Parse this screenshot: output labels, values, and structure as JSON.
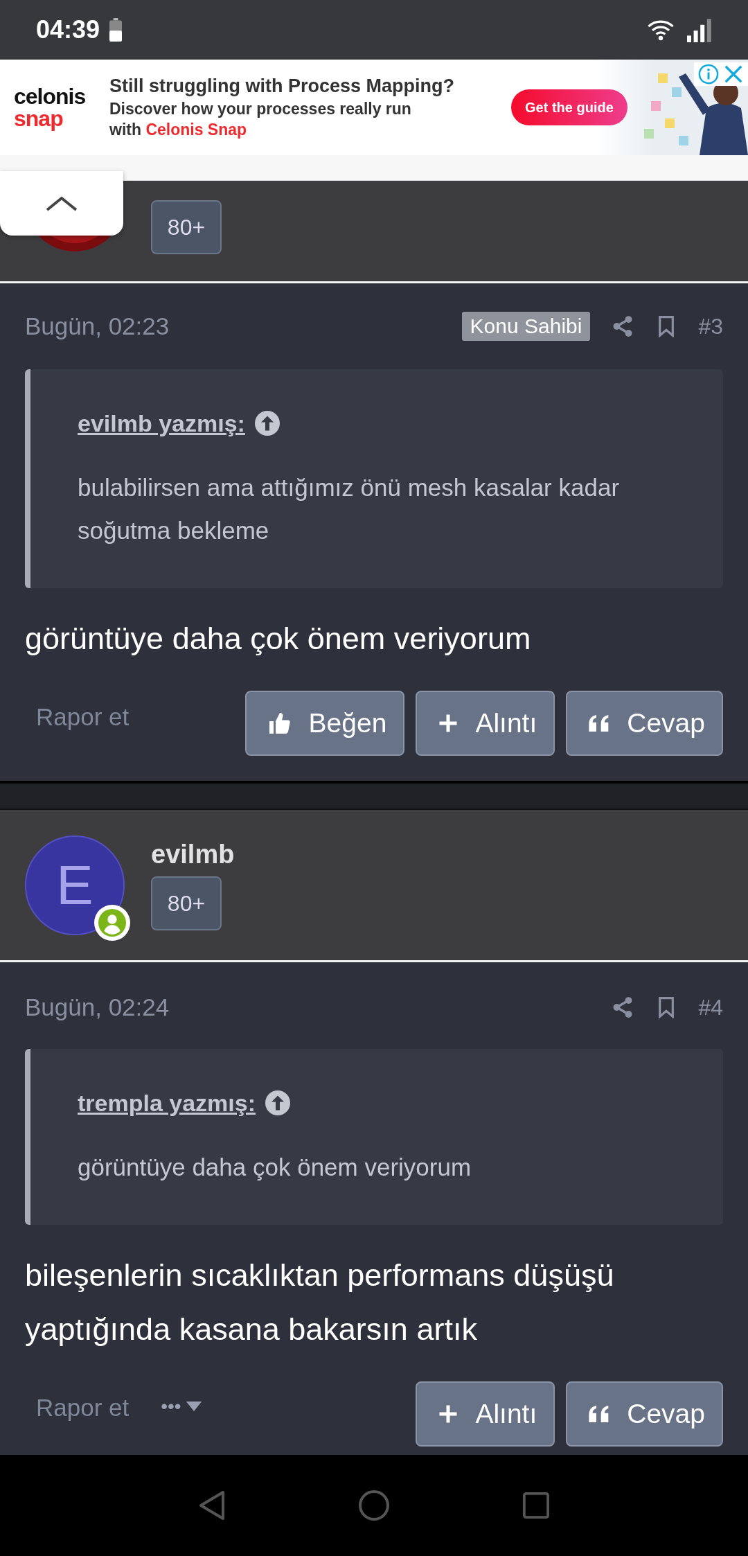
{
  "status_bar": {
    "time": "04:39"
  },
  "ad": {
    "logo_top": "celonis",
    "logo_bottom": "snap",
    "headline": "Still struggling with Process Mapping?",
    "body": "Discover how your processes really run with",
    "body_highlight": "Celonis Snap",
    "cta": "Get the guide"
  },
  "posts": [
    {
      "author": {
        "badge": "80+"
      },
      "date": "Bugün, 02:23",
      "owner_tag": "Konu Sahibi",
      "number": "#3",
      "quote": {
        "author": "evilmb yazmış:",
        "text": "bulabilirsen ama attığımız önü mesh kasalar kadar soğutma bekleme"
      },
      "body": "görüntüye daha çok önem veriyorum",
      "report": "Rapor et",
      "actions": [
        {
          "kind": "like",
          "label": "Beğen"
        },
        {
          "kind": "quote",
          "label": "Alıntı"
        },
        {
          "kind": "reply",
          "label": "Cevap"
        }
      ]
    },
    {
      "author": {
        "kind": "letter",
        "initial": "E",
        "name": "evilmb",
        "badge": "80+",
        "online": true
      },
      "date": "Bugün, 02:24",
      "number": "#4",
      "quote": {
        "author": "trempla yazmış:",
        "text": "görüntüye daha çok önem veriyorum"
      },
      "body": "bileşenlerin sıcaklıktan performans düşüşü yaptığında kasana bakarsın artık",
      "report": "Rapor et",
      "more": "•••",
      "actions": [
        {
          "kind": "quote",
          "label": "Alıntı"
        },
        {
          "kind": "reply",
          "label": "Cevap"
        }
      ]
    }
  ]
}
